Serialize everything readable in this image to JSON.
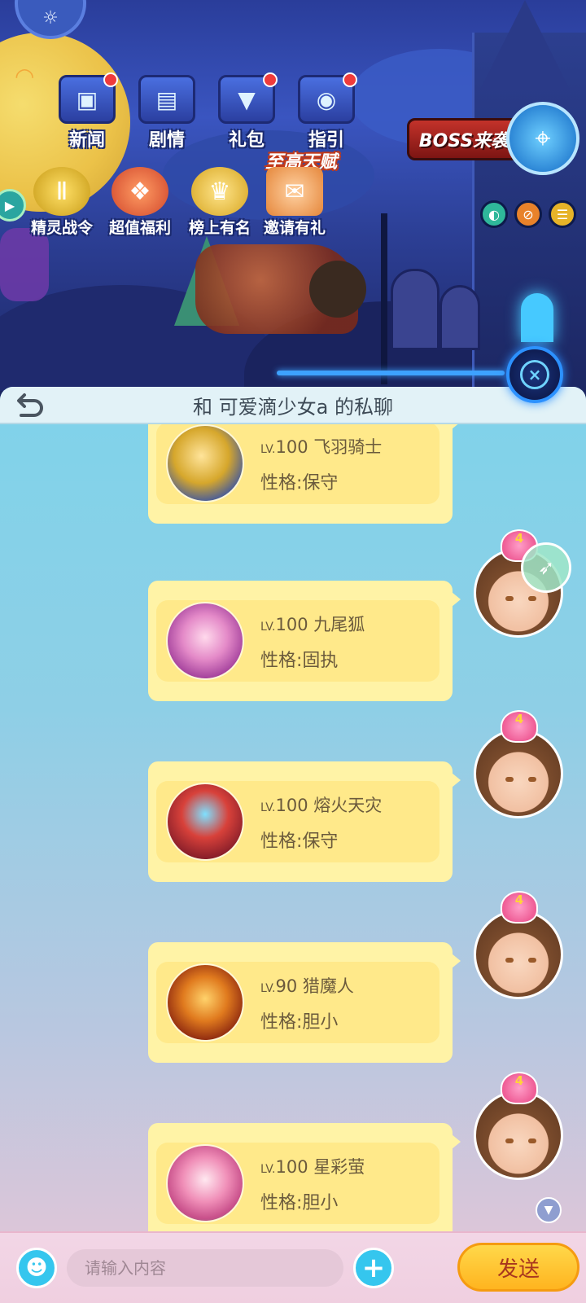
{
  "game_menu": {
    "top_buttons": [
      {
        "label": "新闻",
        "icon": "tv-icon",
        "badge": true
      },
      {
        "label": "剧情",
        "icon": "book-icon",
        "badge": false
      },
      {
        "label": "礼包",
        "icon": "chest-icon",
        "badge": true
      },
      {
        "label": "指引",
        "icon": "safe-icon",
        "badge": true
      }
    ],
    "boss_label": "BOSS来袭",
    "banner_label": "至高天赋",
    "feature_buttons": [
      {
        "label": "精灵战令",
        "icon": "medal-icon"
      },
      {
        "label": "超值福利",
        "icon": "gift-icon"
      },
      {
        "label": "榜上有名",
        "icon": "trophy-icon"
      },
      {
        "label": "邀请有礼",
        "icon": "invite-icon"
      }
    ]
  },
  "chat": {
    "title": "和 可爱滴少女a 的私聊",
    "messages": [
      {
        "level_prefix": "LV.",
        "level": "100",
        "pet_name": "飞羽骑士",
        "nature": "性格:保守",
        "pet_color": "#d6a72c"
      },
      {
        "level_prefix": "LV.",
        "level": "100",
        "pet_name": "九尾狐",
        "nature": "性格:固执",
        "pet_color": "#e48ac8"
      },
      {
        "level_prefix": "LV.",
        "level": "100",
        "pet_name": "熔火天灾",
        "nature": "性格:保守",
        "pet_color": "#d8413a"
      },
      {
        "level_prefix": "LV.",
        "level": "90",
        "pet_name": "猎魔人",
        "nature": "性格:胆小",
        "pet_color": "#e07a1e"
      },
      {
        "level_prefix": "LV.",
        "level": "100",
        "pet_name": "星彩萤",
        "nature": "性格:胆小",
        "pet_color": "#f08fb8"
      }
    ],
    "avatar_badge": "4"
  },
  "input_bar": {
    "placeholder": "请输入内容",
    "send_label": "发送"
  }
}
